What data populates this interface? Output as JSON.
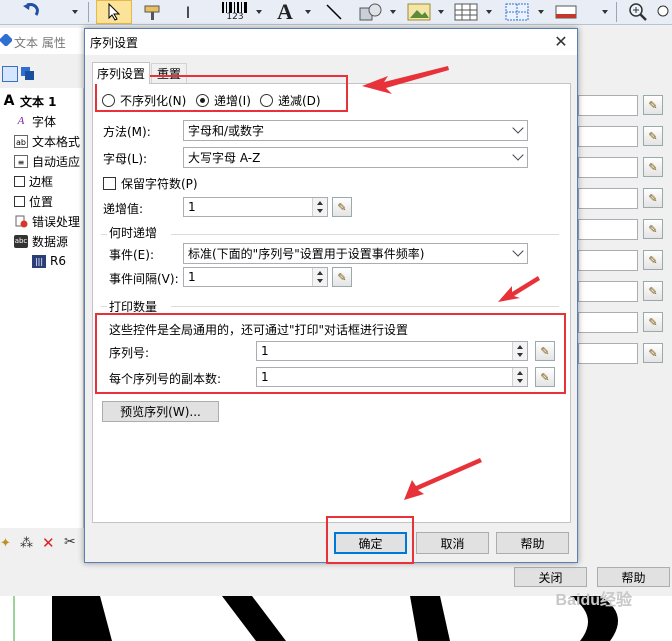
{
  "toolbar": {
    "barcode_caption": "123",
    "text_tool_glyph": "A"
  },
  "background_window": {
    "title": "文本 属性",
    "tree": [
      {
        "label": "文本 1",
        "icon": "text-a-icon"
      },
      {
        "label": "字体",
        "icon": "font-icon"
      },
      {
        "label": "文本格式",
        "icon": "text-format-icon"
      },
      {
        "label": "自动适应",
        "icon": "auto-fit-icon"
      },
      {
        "label": "边框",
        "icon": "border-icon"
      },
      {
        "label": "位置",
        "icon": "position-icon"
      },
      {
        "label": "错误处理",
        "icon": "error-handling-icon"
      },
      {
        "label": "数据源",
        "icon": "data-source-icon"
      },
      {
        "label": "R6",
        "icon": "sequence-icon"
      }
    ],
    "close_label": "关闭",
    "help_label": "帮助"
  },
  "dialog": {
    "title": "序列设置",
    "tabs": [
      "序列设置",
      "重置"
    ],
    "radios": [
      {
        "label": "不序列化(N)",
        "selected": false
      },
      {
        "label": "递增(I)",
        "selected": true
      },
      {
        "label": "递减(D)",
        "selected": false
      }
    ],
    "method_label": "方法(M):",
    "method_value": "字母和/或数字",
    "letters_label": "字母(L):",
    "letters_value": "大写字母 A-Z",
    "keep_char_count_label": "保留字符数(P)",
    "increment_label": "递增值:",
    "increment_value": "1",
    "when_increment_title": "何时递增",
    "event_label": "事件(E):",
    "event_value": "标准(下面的\"序列号\"设置用于设置事件频率)",
    "event_interval_label": "事件间隔(V):",
    "event_interval_value": "1",
    "print_quantity_title": "打印数量",
    "global_note": "这些控件是全局通用的，还可通过\"打印\"对话框进行设置",
    "serial_label": "序列号:",
    "serial_value": "1",
    "copies_label": "每个序列号的副本数:",
    "copies_value": "1",
    "preview_button": "预览序列(W)...",
    "ok_button": "确定",
    "cancel_button": "取消",
    "help_button": "帮助"
  },
  "watermark": "Baidu经验",
  "colors": {
    "highlight_red": "#e8323a",
    "default_button_border": "#0078d7"
  }
}
